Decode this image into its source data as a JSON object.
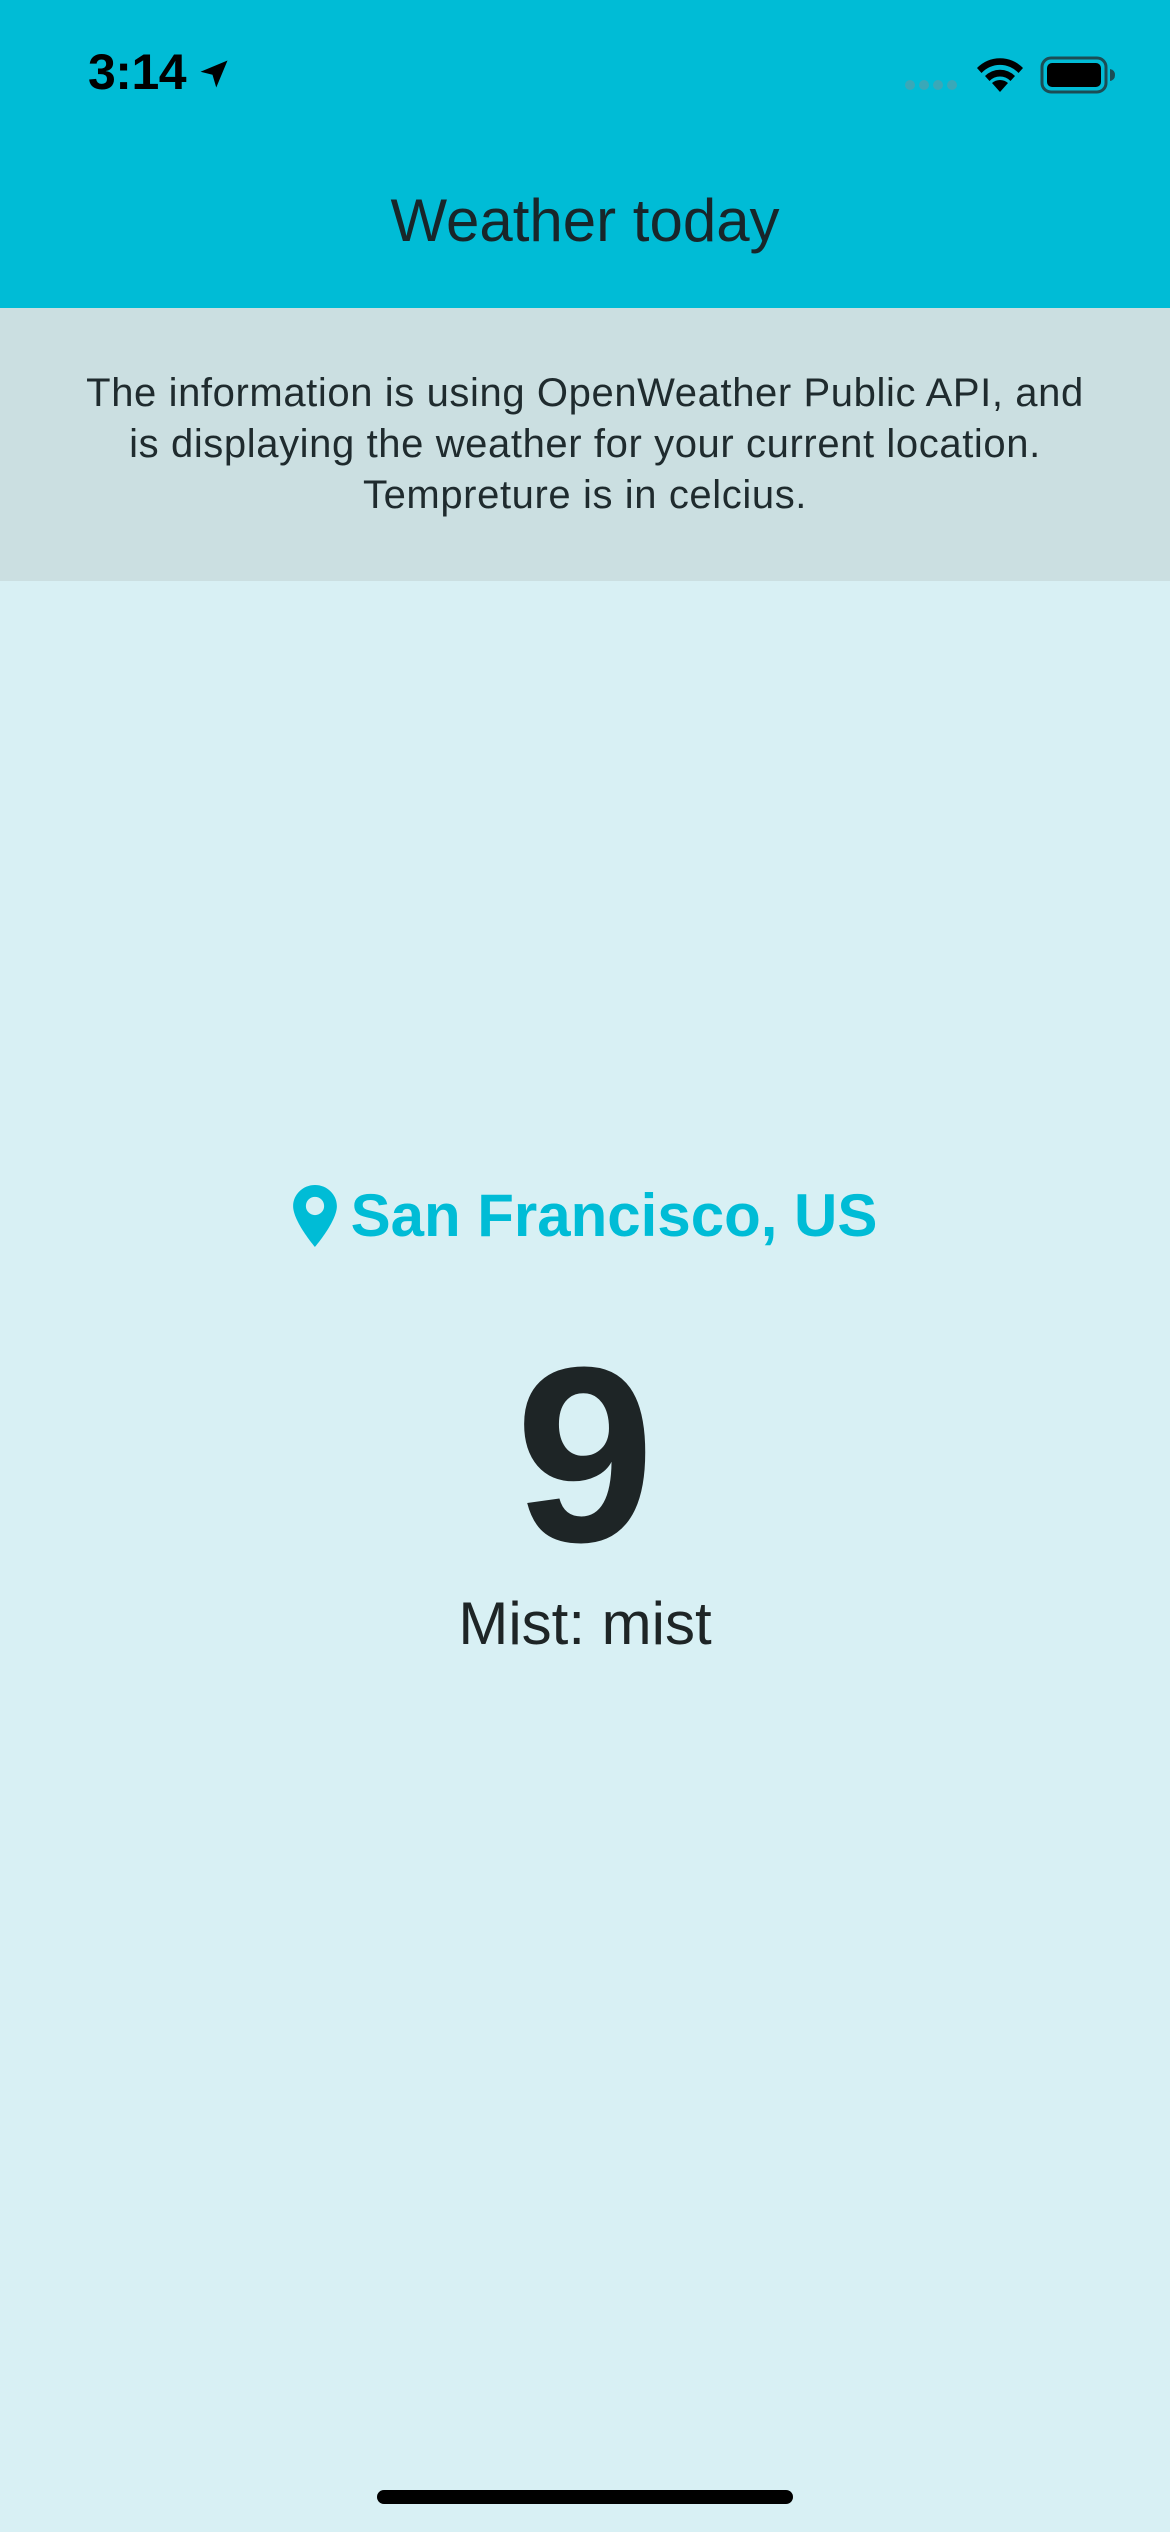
{
  "status_bar": {
    "time": "3:14",
    "icons": [
      "location-arrow-icon",
      "cellular-signal-icon",
      "wifi-icon",
      "battery-icon"
    ]
  },
  "header": {
    "title": "Weather today",
    "background": "#00bcd6"
  },
  "info_banner": {
    "text": "The information is using OpenWeather Public API, and is displaying the weather for your current location. Tempreture is in celcius.",
    "background": "#cbdfe1"
  },
  "weather": {
    "location_icon": "map-pin-icon",
    "location": "San Francisco, US",
    "temperature": "9",
    "condition": "Mist: mist",
    "accent_color": "#00bcd6"
  },
  "page_background": "#d8f0f4"
}
